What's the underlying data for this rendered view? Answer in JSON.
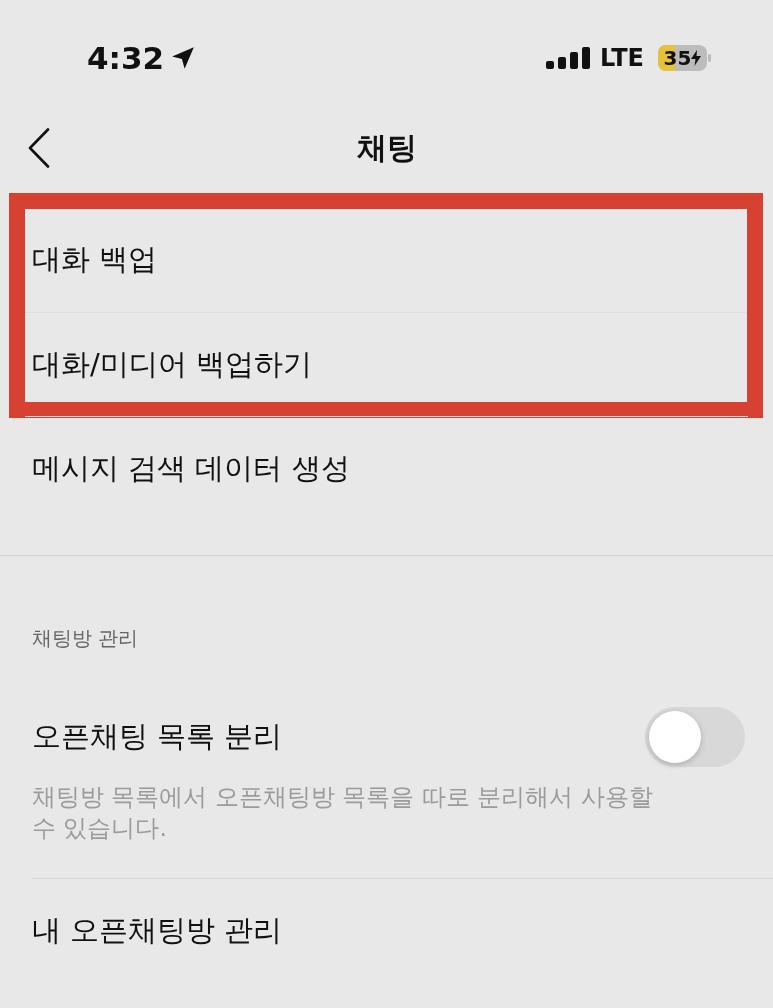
{
  "status_bar": {
    "time": "4:32",
    "network": "LTE",
    "battery": "35",
    "low_power_mode": true,
    "charging": true
  },
  "header": {
    "title": "채팅"
  },
  "sections": [
    {
      "rows": [
        {
          "kind": "link",
          "label": "대화 백업",
          "highlighted": true
        },
        {
          "kind": "link",
          "label": "대화/미디어 백업하기",
          "highlighted": true
        },
        {
          "kind": "link",
          "label": "메시지 검색 데이터 생성",
          "highlighted": false
        }
      ]
    },
    {
      "header": "채팅방 관리",
      "rows": [
        {
          "kind": "toggle",
          "label": "오픈채팅 목록 분리",
          "on": false,
          "highlighted": false,
          "description": "채팅방 목록에서 오픈채팅방 목록을 따로 분리해서 사용할 수 있습니다."
        },
        {
          "kind": "link",
          "label": "내 오픈채팅방 관리",
          "highlighted": false
        }
      ]
    }
  ]
}
